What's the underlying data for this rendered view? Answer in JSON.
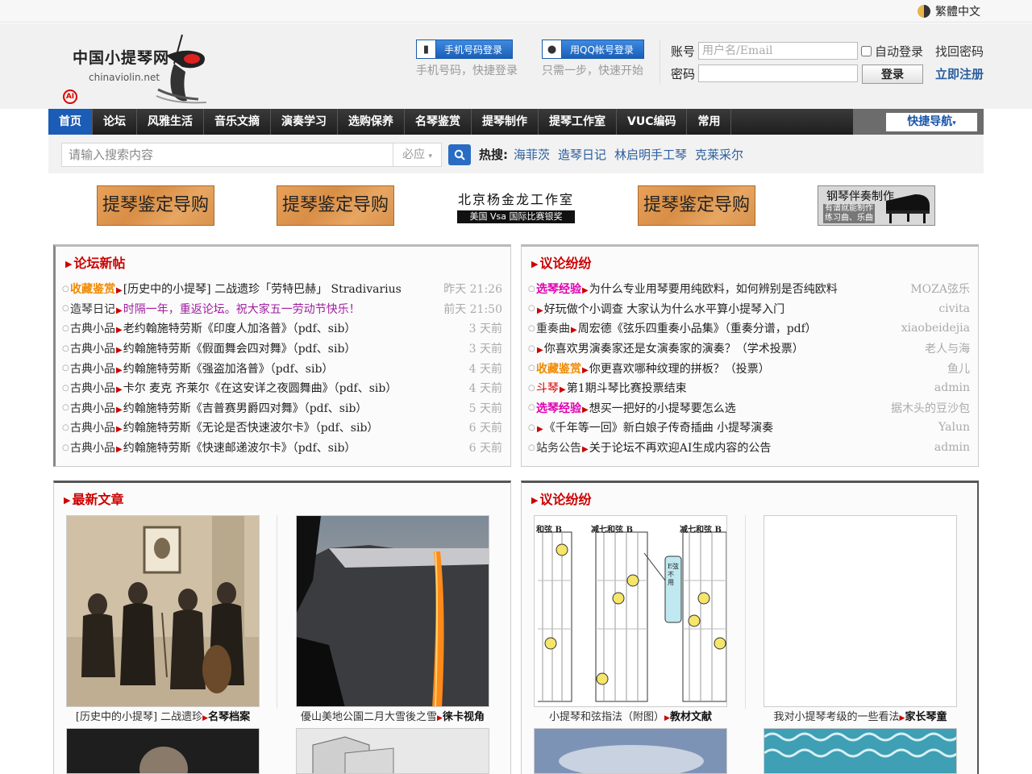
{
  "top": {
    "language": "繁體中文"
  },
  "logo": {
    "name_cn": "中国小提琴网",
    "name_en": "chinaviolin.net",
    "ai_badge": "AI"
  },
  "login": {
    "phone_button": "手机号码登录",
    "phone_sub": "手机号码，快捷登录",
    "qq_button": "用QQ帐号登录",
    "qq_sub": "只需一步，快速开始",
    "account_label": "账号",
    "account_placeholder": "用户名/Email",
    "password_label": "密码",
    "auto_login": "自动登录",
    "find_password": "找回密码",
    "login_button": "登录",
    "register": "立即注册"
  },
  "nav": {
    "items": [
      "首页",
      "论坛",
      "风雅生活",
      "音乐文摘",
      "演奏学习",
      "选购保养",
      "名琴鉴赏",
      "提琴制作",
      "提琴工作室",
      "VUC编码",
      "常用"
    ],
    "quick": "快捷导航"
  },
  "search": {
    "placeholder": "请输入搜索内容",
    "engine": "必应",
    "hot_label": "热搜:",
    "hot": [
      "海菲茨",
      "造琴日记",
      "林启明手工琴",
      "克莱采尔"
    ]
  },
  "banners": {
    "wood_text": "提琴鉴定导购",
    "studio_title": "北京杨金龙工作室",
    "studio_sub": "美国 Vsa 国际比赛银奖",
    "piano_title": "钢琴伴奏制作",
    "piano_sub1": "有谱就能制作",
    "piano_sub2": "练习曲、乐曲"
  },
  "forum_new": {
    "title": "论坛新帖",
    "rows": [
      {
        "cat": "收藏鉴赏",
        "catStyle": "catO",
        "title": "[历史中的小提琴] 二战遗珍「劳特巴赫」 Stradivarius",
        "meta": "昨天 21:26"
      },
      {
        "cat": "造琴日记",
        "catStyle": "cat",
        "title": "时隔一年，重返论坛。祝大家五一劳动节快乐！",
        "titleStyle": "purple",
        "meta": "前天 21:50"
      },
      {
        "cat": "古典小品",
        "catStyle": "cat",
        "title": "老约翰施特劳斯《印度人加洛普》（pdf、sib）",
        "meta": "3 天前"
      },
      {
        "cat": "古典小品",
        "catStyle": "cat",
        "title": "约翰施特劳斯《假面舞会四对舞》（pdf、sib）",
        "meta": "3 天前"
      },
      {
        "cat": "古典小品",
        "catStyle": "cat",
        "title": "约翰施特劳斯《强盗加洛普》（pdf、sib）",
        "meta": "4 天前"
      },
      {
        "cat": "古典小品",
        "catStyle": "cat",
        "title": "卡尔 麦克 齐莱尔《在这安详之夜圆舞曲》（pdf、sib）",
        "meta": "4 天前"
      },
      {
        "cat": "古典小品",
        "catStyle": "cat",
        "title": "约翰施特劳斯《吉普赛男爵四对舞》（pdf、sib）",
        "meta": "5 天前"
      },
      {
        "cat": "古典小品",
        "catStyle": "cat",
        "title": "约翰施特劳斯《无论是否快速波尔卡》（pdf、sib）",
        "meta": "6 天前"
      },
      {
        "cat": "古典小品",
        "catStyle": "cat",
        "title": "约翰施特劳斯《快速邮递波尔卡》（pdf、sib）",
        "meta": "6 天前"
      }
    ]
  },
  "discussion": {
    "title": "议论纷纷",
    "rows": [
      {
        "cat": "选琴经验",
        "catStyle": "catM",
        "title": "为什么专业用琴要用纯欧料，如何辨别是否纯欧料",
        "meta": "MOZA弦乐"
      },
      {
        "cat": "",
        "catStyle": "cat",
        "title": "好玩做个小调查 大家认为什么水平算小提琴入门",
        "meta": "civita"
      },
      {
        "cat": "重奏曲",
        "catStyle": "cat",
        "title": "周宏德《弦乐四重奏小品集》（重奏分谱，pdf）",
        "meta": "xiaobeidejia"
      },
      {
        "cat": "",
        "catStyle": "cat",
        "title": "你喜欢男演奏家还是女演奏家的演奏？（学术投票）",
        "meta": "老人与海"
      },
      {
        "cat": "收藏鉴赏",
        "catStyle": "catO",
        "title": "你更喜欢哪种纹理的拼板？（投票）",
        "meta": "鱼儿"
      },
      {
        "cat": "斗琴",
        "catStyle": "catR",
        "title": "第1期斗琴比赛投票结束",
        "meta": "admin"
      },
      {
        "cat": "选琴经验",
        "catStyle": "catM",
        "title": "想买一把好的小提琴要怎么选",
        "meta": "据木头的豆沙包"
      },
      {
        "cat": "",
        "catStyle": "cat",
        "title": "《千年等一回》新白娘子传奇插曲 小提琴演奏",
        "meta": "Yalun"
      },
      {
        "cat": "站务公告",
        "catStyle": "cat",
        "title": "关于论坛不再欢迎AI生成内容的公告",
        "meta": "admin"
      }
    ]
  },
  "latest_articles": {
    "title": "最新文章",
    "items": [
      {
        "caption": "[历史中的小提琴] 二战遗珍",
        "tag": "名琴档案"
      },
      {
        "caption": "優山美地公園二月大雪後之雪",
        "tag": "徕卡视角"
      }
    ]
  },
  "discussion2": {
    "title": "议论纷纷",
    "items": [
      {
        "caption": "小提琴和弦指法（附图）",
        "tag": "教材文献"
      },
      {
        "caption": "我对小提琴考级的一些看法",
        "tag": "家长琴童"
      }
    ],
    "chord_labels": [
      "减七和弦 B",
      "减七和弦 B",
      "和弦 B",
      "E弦不用"
    ]
  }
}
